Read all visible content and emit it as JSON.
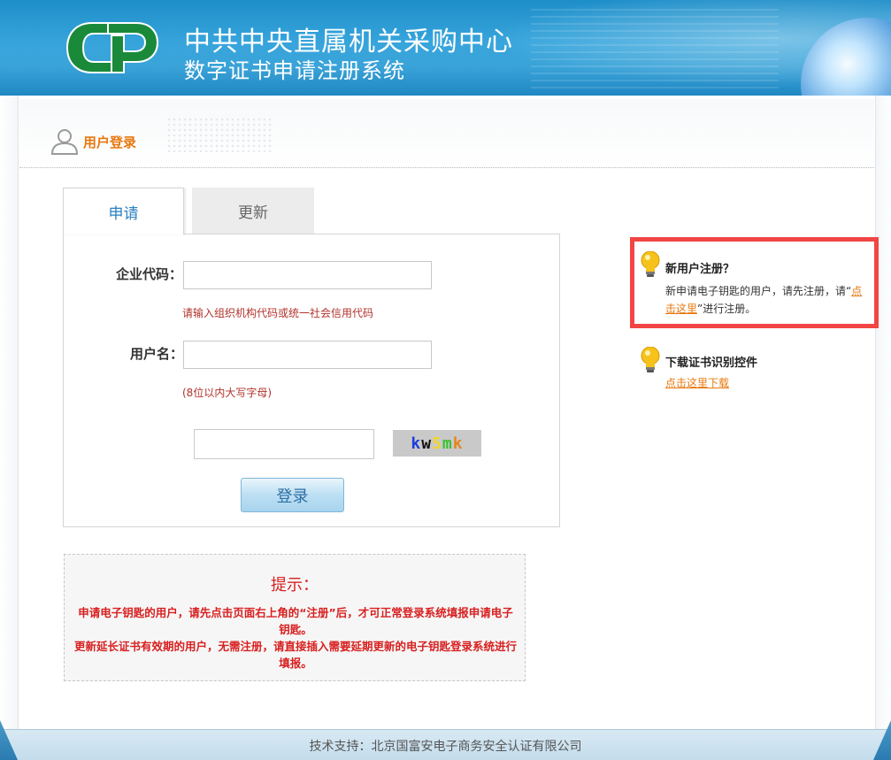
{
  "header": {
    "title_line1": "中共中央直属机关采购中心",
    "title_line2": "数字证书申请注册系统"
  },
  "login_section": {
    "title": "用户登录"
  },
  "tabs": [
    {
      "label": "申请",
      "active": true
    },
    {
      "label": "更新",
      "active": false
    }
  ],
  "form": {
    "company_code_label": "企业代码：",
    "company_code_value": "",
    "company_code_hint": "请输入组织机构代码或统一社会信用代码",
    "username_label": "用户名：",
    "username_value": "",
    "username_hint": "(8位以内大写字母)",
    "captcha_value": "",
    "captcha_text": {
      "chars": [
        {
          "ch": "k",
          "color": "#1d3fd8"
        },
        {
          "ch": "w",
          "color": "#111111"
        },
        {
          "ch": "5",
          "color": "#f0d62a"
        },
        {
          "ch": "m",
          "color": "#39c22f"
        },
        {
          "ch": "k",
          "color": "#e6861b"
        }
      ]
    },
    "login_button": "登录"
  },
  "tips": {
    "title": "提示：",
    "line1": "申请电子钥匙的用户，请先点击页面右上角的“注册”后，才可正常登录系统填报申请电子钥匙。",
    "line2": "更新延长证书有效期的用户，无需注册，请直接插入需要延期更新的电子钥匙登录系统进行填报。"
  },
  "sidebar": {
    "register": {
      "title": "新用户注册？",
      "text_before": "新申请电子钥匙的用户，请先注册，请“",
      "link": "点击这里",
      "text_after": "”进行注册。"
    },
    "download": {
      "title": "下载证书识别控件",
      "link": "点击这里下载"
    }
  },
  "footer": {
    "text": "技术支持：北京国富安电子商务安全认证有限公司"
  },
  "colors": {
    "header_blue": "#2a9ad3",
    "accent_orange": "#e8780f",
    "warning_red": "#d81f1f",
    "highlight_box": "#f24545",
    "logo_green": "#1a8a3a"
  }
}
